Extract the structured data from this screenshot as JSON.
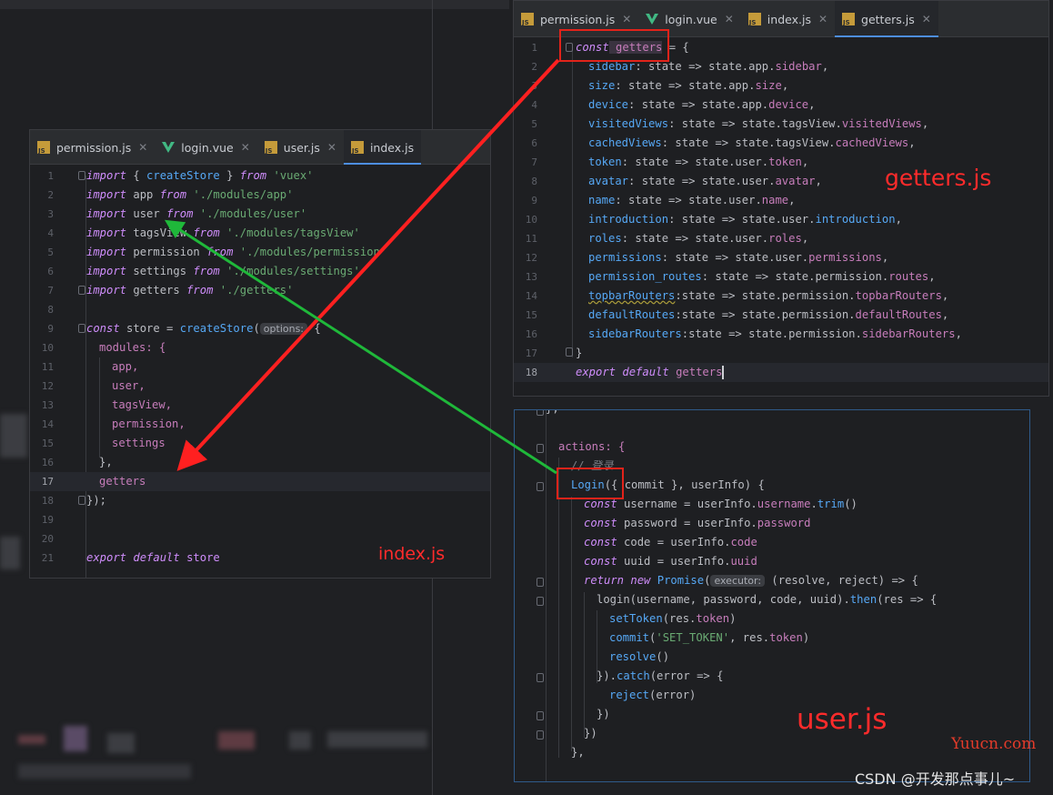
{
  "index_panel": {
    "tabs": [
      {
        "name": "permission.js",
        "icon": "js-file-icon",
        "active": false
      },
      {
        "name": "login.vue",
        "icon": "vue-file-icon",
        "active": false
      },
      {
        "name": "user.js",
        "icon": "js-file-icon",
        "active": false
      },
      {
        "name": "index.js",
        "icon": "js-file-icon",
        "active": true
      }
    ],
    "line_numbers": [
      "1",
      "2",
      "3",
      "4",
      "5",
      "6",
      "7",
      "8",
      "9",
      "10",
      "11",
      "12",
      "13",
      "14",
      "15",
      "16",
      "17",
      "18",
      "19",
      "20",
      "21"
    ],
    "label": "index.js",
    "code": {
      "l1_kw1": "import",
      "l1_a": " { ",
      "l1_fn": "createStore",
      "l1_b": " } ",
      "l1_kw2": "from",
      "l1_str": " 'vuex'",
      "l2_kw1": "import",
      "l2_a": " app ",
      "l2_kw2": "from",
      "l2_str": " './modules/app'",
      "l3_kw1": "import",
      "l3_a": " user ",
      "l3_kw2": "from",
      "l3_str": " './modules/user'",
      "l4_kw1": "import",
      "l4_a": " tagsView ",
      "l4_kw2": "from",
      "l4_str": " './modules/tagsView'",
      "l5_kw1": "import",
      "l5_a": " permission ",
      "l5_kw2": "from",
      "l5_str": " './modules/permission'",
      "l6_kw1": "import",
      "l6_a": " settings ",
      "l6_kw2": "from",
      "l6_str": " './modules/settings'",
      "l7_kw1": "import",
      "l7_a": " getters ",
      "l7_kw2": "from",
      "l7_str": " './getters'",
      "l9_kw": "const",
      "l9_a": " store = ",
      "l9_fn": "createStore",
      "l9_b": "(",
      "l9_hint": "options:",
      "l9_c": " {",
      "l10": "modules: {",
      "l11": "app,",
      "l12": "user,",
      "l13": "tagsView,",
      "l14": "permission,",
      "l15": "settings",
      "l16": "},",
      "l17": "getters",
      "l18": "});",
      "l21_kw1": "export",
      "l21_kw2": " default",
      "l21_a": " store"
    }
  },
  "getters_panel": {
    "tabs": [
      {
        "name": "permission.js",
        "icon": "js-file-icon",
        "active": false
      },
      {
        "name": "login.vue",
        "icon": "vue-file-icon",
        "active": false
      },
      {
        "name": "index.js",
        "icon": "js-file-icon",
        "active": false
      },
      {
        "name": "getters.js",
        "icon": "js-file-icon",
        "active": true
      }
    ],
    "line_numbers": [
      "1",
      "2",
      "3",
      "4",
      "5",
      "6",
      "7",
      "8",
      "9",
      "10",
      "11",
      "12",
      "13",
      "14",
      "15",
      "16",
      "17",
      "18"
    ],
    "label": "getters.js",
    "code": {
      "l1_kw": "const",
      "l1_a": " getters",
      "l1_b": " = {",
      "rows": [
        {
          "k": "sidebar",
          "v": ": state => state.app.",
          "p": "sidebar",
          "e": ","
        },
        {
          "k": "size",
          "v": ": state => state.app.",
          "p": "size",
          "e": ","
        },
        {
          "k": "device",
          "v": ": state => state.app.",
          "p": "device",
          "e": ","
        },
        {
          "k": "visitedViews",
          "v": ": state => state.tagsView.",
          "p": "visitedViews",
          "e": ","
        },
        {
          "k": "cachedViews",
          "v": ": state => state.tagsView.",
          "p": "cachedViews",
          "e": ","
        },
        {
          "k": "token",
          "v": ": state => state.user.",
          "p": "token",
          "e": ","
        },
        {
          "k": "avatar",
          "v": ": state => state.user.",
          "p": "avatar",
          "e": ","
        },
        {
          "k": "name",
          "v": ": state => state.user.",
          "p": "name",
          "e": ","
        },
        {
          "k": "introduction",
          "v": ": state => state.user.",
          "p": "introduction",
          "e": ","
        },
        {
          "k": "roles",
          "v": ": state => state.user.",
          "p": "roles",
          "e": ","
        },
        {
          "k": "permissions",
          "v": ": state => state.user.",
          "p": "permissions",
          "e": ","
        },
        {
          "k": "permission_routes",
          "v": ": state => state.permission.",
          "p": "routes",
          "e": ","
        },
        {
          "k": "topbarRouters",
          "v": ":state => state.permission.",
          "p": "topbarRouters",
          "e": ","
        },
        {
          "k": "defaultRoutes",
          "v": ":state => state.permission.",
          "p": "defaultRoutes",
          "e": ","
        },
        {
          "k": "sidebarRouters",
          "v": ":state => state.permission.",
          "p": "sidebarRouters",
          "e": ","
        }
      ],
      "l17": "}",
      "l18_kw1": "export",
      "l18_kw2": " default",
      "l18_a": " getters"
    }
  },
  "user_panel": {
    "label": "user.js",
    "code": {
      "l0": "},",
      "l1": "actions: {",
      "l2": "// 登录",
      "l3_fn": "Login",
      "l3_a": "({ commit }, userInfo) {",
      "l4_kw": "const",
      "l4_a": " username = userInfo.",
      "l4_p": "username",
      "l4_b": ".",
      "l4_fn": "trim",
      "l4_c": "()",
      "l5_kw": "const",
      "l5_a": " password = userInfo.",
      "l5_p": "password",
      "l6_kw": "const",
      "l6_a": " code = userInfo.",
      "l6_p": "code",
      "l7_kw": "const",
      "l7_a": " uuid = userInfo.",
      "l7_p": "uuid",
      "l8_kw1": "return",
      "l8_kw2": " new",
      "l8_fn": " Promise",
      "l8_a": "(",
      "l8_hint": "executor:",
      "l8_b": " (resolve, reject) => {",
      "l9_a": "login(username, password, code, uuid).",
      "l9_fn": "then",
      "l9_b": "(res => {",
      "l10_fn": "setToken",
      "l10_a": "(res.",
      "l10_p": "token",
      "l10_b": ")",
      "l11_fn": "commit",
      "l11_a": "(",
      "l11_str": "'SET_TOKEN'",
      "l11_b": ", res.",
      "l11_p": "token",
      "l11_c": ")",
      "l12_fn": "resolve",
      "l12_a": "()",
      "l13_a": "}).",
      "l13_fn": "catch",
      "l13_b": "(error => {",
      "l14_fn": "reject",
      "l14_a": "(error)",
      "l15": "})",
      "l16": "})",
      "l17": "},"
    }
  },
  "watermark": "CSDN @开发那点事儿~",
  "site_mark": "Yuucn.com",
  "colors": {
    "arrow_red": "#ff2020",
    "arrow_green": "#1fb83a",
    "accent": "#4d8ee0"
  }
}
